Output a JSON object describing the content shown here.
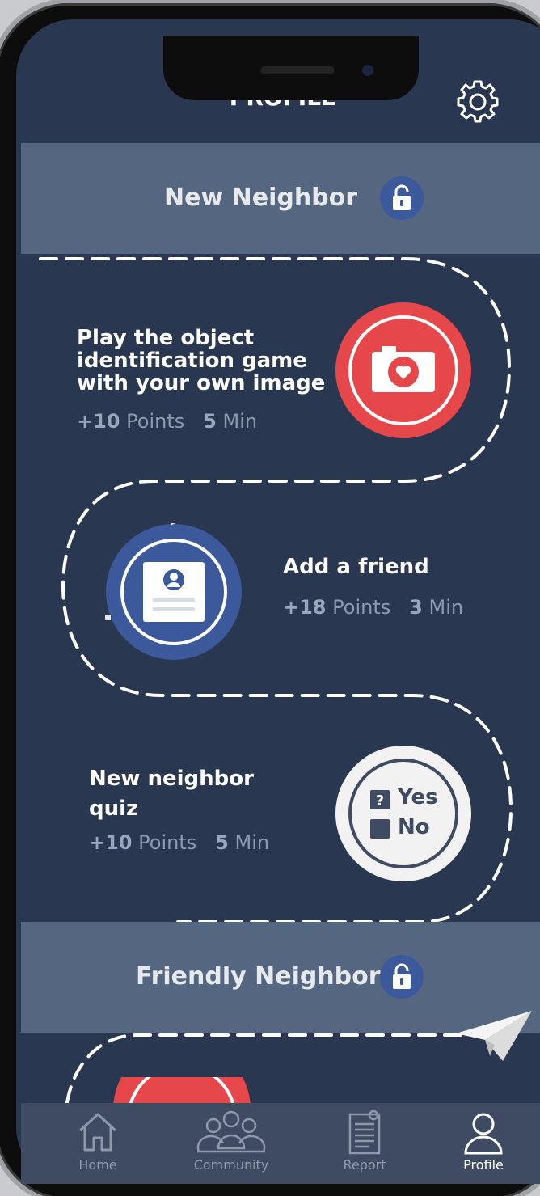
{
  "header": {
    "title": "PROFILE",
    "settings_icon": "gear-icon"
  },
  "levels": [
    {
      "label": "New Neighbor",
      "icon": "unlock-icon"
    },
    {
      "label": "Friendly Neighbor",
      "icon": "unlock-icon"
    }
  ],
  "tasks": [
    {
      "title_lines": [
        "Play the object",
        "identification game",
        "with your own image"
      ],
      "points": "+10",
      "points_label": "Points",
      "minutes": "5",
      "minutes_label": "Min",
      "icon": "camera-heart-icon"
    },
    {
      "title_lines": [
        "Add a friend"
      ],
      "points": "+18",
      "points_label": "Points",
      "minutes": "3",
      "minutes_label": "Min",
      "icon": "profile-card-icon"
    },
    {
      "title_lines": [
        "New neighbor",
        "quiz"
      ],
      "points": "+10",
      "points_label": "Points",
      "minutes": "5",
      "minutes_label": "Min",
      "icon": "quiz-icon",
      "quiz_options": [
        "Yes",
        "No"
      ]
    }
  ],
  "nav": {
    "items": [
      {
        "label": "Home",
        "icon": "home-icon"
      },
      {
        "label": "Community",
        "icon": "community-icon"
      },
      {
        "label": "Report",
        "icon": "report-icon"
      },
      {
        "label": "Profile",
        "icon": "profile-icon"
      }
    ],
    "active": "Profile"
  },
  "colors": {
    "background": "#293750",
    "band": "#546680",
    "accent_red": "#e5474b",
    "accent_blue": "#3c5a9b",
    "text_muted": "#8e9ab0"
  }
}
